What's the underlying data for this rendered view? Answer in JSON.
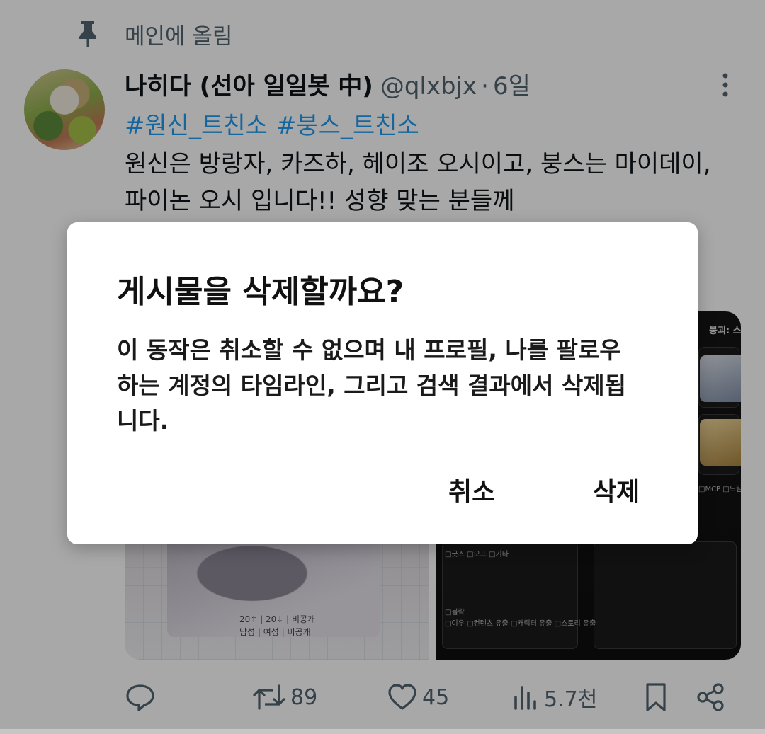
{
  "pinned": {
    "label": "메인에 올림",
    "icon": "pin-icon"
  },
  "tweet": {
    "display_name": "나히다 (선아 일일봇 中)",
    "handle": "@qlxbjx",
    "separator": "·",
    "time": "6일",
    "hashtags": [
      "#원신_트친소",
      "#붕스_트친소"
    ],
    "text": "원신은 방랑자, 카즈하, 헤이조 오시이고, 붕스는 마이데이, 파이논 오시 입니다!! 성향 맞는 분들께",
    "media_right_title": "붕괴: 스",
    "media_left_meta_line1": "20↑ | 20↓ | 비공개",
    "media_left_meta_line2": "남성 | 여성 | 비공개",
    "media_right_captions": [
      "□MCP  □드림",
      "□굿즈  □오프  □기타",
      "□블락",
      "□이우  □컨텐츠 유출  □캐릭터 유출  □스토리 유출"
    ]
  },
  "actions": {
    "reply": {
      "icon": "reply-icon",
      "count": ""
    },
    "retweet": {
      "icon": "retweet-icon",
      "count": "89"
    },
    "like": {
      "icon": "heart-icon",
      "count": "45"
    },
    "views": {
      "icon": "views-icon",
      "count": "5.7천"
    },
    "bookmark": {
      "icon": "bookmark-icon"
    },
    "share": {
      "icon": "share-icon"
    }
  },
  "dialog": {
    "title": "게시물을 삭제할까요?",
    "message": "이 동작은 취소할 수 없으며 내 프로필, 나를 팔로우하는 계정의 타임라인, 그리고 검색 결과에서 삭제됩니다.",
    "cancel_label": "취소",
    "delete_label": "삭제"
  },
  "colors": {
    "accent": "#1d9bf0",
    "secondary_text": "#536471",
    "overlay": "rgba(0,0,0,0.34)"
  }
}
